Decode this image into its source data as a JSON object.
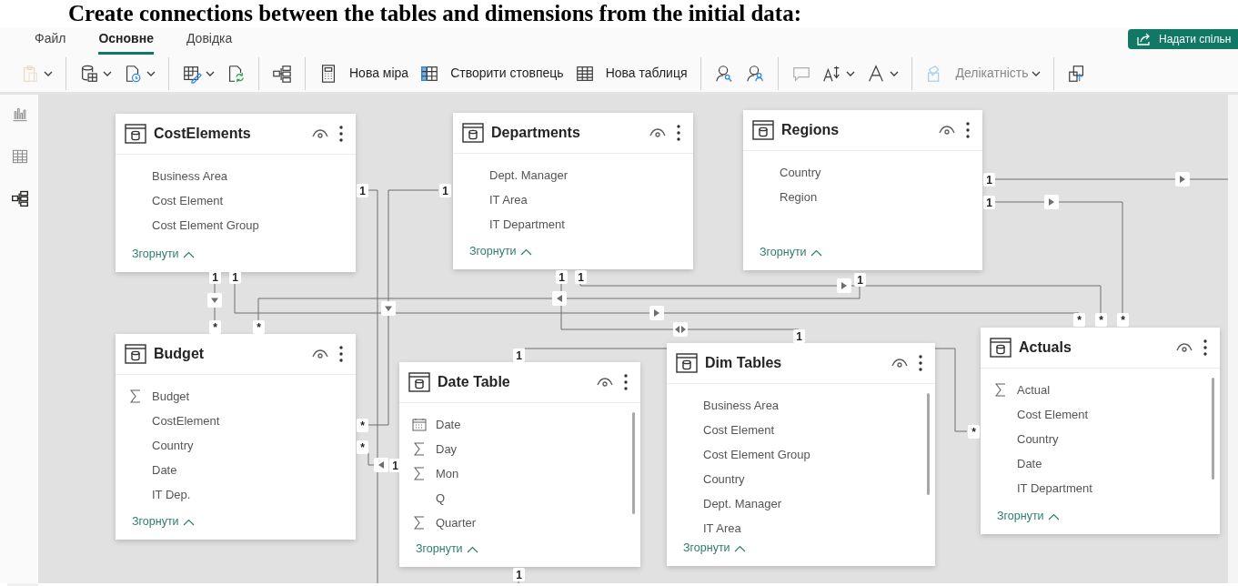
{
  "document_heading": "Create connections between the tables and dimensions from the initial data:",
  "menu": [
    {
      "label": "Файл",
      "selected": false
    },
    {
      "label": "Основне",
      "selected": true
    },
    {
      "label": "Довідка",
      "selected": false
    }
  ],
  "share_button": {
    "label": "Надати спільн"
  },
  "toolbar": [
    {
      "kind": "button",
      "dropdown": true,
      "disabled": true
    },
    {
      "kind": "separator"
    },
    {
      "kind": "button",
      "dropdown": true,
      "disabled": false
    },
    {
      "kind": "button",
      "dropdown": true,
      "disabled": false
    },
    {
      "kind": "separator"
    },
    {
      "kind": "button",
      "dropdown": true,
      "disabled": false
    },
    {
      "kind": "button",
      "dropdown": false,
      "disabled": false
    },
    {
      "kind": "separator"
    },
    {
      "kind": "button",
      "dropdown": false,
      "disabled": false
    },
    {
      "kind": "separator"
    },
    {
      "kind": "button",
      "label": "Нова міра",
      "dropdown": false,
      "disabled": false
    },
    {
      "kind": "button",
      "label": "Створити стовпець",
      "dropdown": false,
      "disabled": false
    },
    {
      "kind": "button",
      "label": "Нова таблиця",
      "dropdown": false,
      "disabled": false
    },
    {
      "kind": "separator"
    },
    {
      "kind": "button",
      "dropdown": false,
      "disabled": false
    },
    {
      "kind": "button",
      "dropdown": false,
      "disabled": false
    },
    {
      "kind": "separator"
    },
    {
      "kind": "button",
      "dropdown": false,
      "disabled": true
    },
    {
      "kind": "button",
      "dropdown": true,
      "disabled": false
    },
    {
      "kind": "button",
      "dropdown": true,
      "disabled": false
    },
    {
      "kind": "separator"
    },
    {
      "kind": "button",
      "label": "Делікатність",
      "dropdown": true,
      "disabled": true
    },
    {
      "kind": "separator"
    },
    {
      "kind": "button",
      "dropdown": false,
      "disabled": false
    }
  ],
  "rail": [
    {
      "selected": false
    },
    {
      "selected": false
    },
    {
      "selected": true
    }
  ],
  "tables": [
    {
      "name": "CostElements",
      "collapse_label": "Згорнути",
      "scrollable": false,
      "fields": [
        {
          "name": "Business Area",
          "kind": "column"
        },
        {
          "name": "Cost Element",
          "kind": "column"
        },
        {
          "name": "Cost Element Group",
          "kind": "column"
        }
      ]
    },
    {
      "name": "Departments",
      "collapse_label": "Згорнути",
      "scrollable": false,
      "fields": [
        {
          "name": "Dept. Manager",
          "kind": "column"
        },
        {
          "name": "IT Area",
          "kind": "column"
        },
        {
          "name": "IT Department",
          "kind": "column"
        }
      ]
    },
    {
      "name": "Regions",
      "collapse_label": "Згорнути",
      "scrollable": false,
      "fields": [
        {
          "name": "Country",
          "kind": "column"
        },
        {
          "name": "Region",
          "kind": "column"
        }
      ]
    },
    {
      "name": "Budget",
      "collapse_label": "Згорнути",
      "scrollable": false,
      "fields": [
        {
          "name": "Budget",
          "kind": "measure"
        },
        {
          "name": "CostElement",
          "kind": "column"
        },
        {
          "name": "Country",
          "kind": "column"
        },
        {
          "name": "Date",
          "kind": "column"
        },
        {
          "name": "IT Dep.",
          "kind": "column"
        }
      ]
    },
    {
      "name": "Date Table",
      "collapse_label": "Згорнути",
      "scrollable": true,
      "fields": [
        {
          "name": "Date",
          "kind": "date"
        },
        {
          "name": "Day",
          "kind": "measure"
        },
        {
          "name": "Mon",
          "kind": "measure"
        },
        {
          "name": "Q",
          "kind": "column"
        },
        {
          "name": "Quarter",
          "kind": "measure"
        }
      ]
    },
    {
      "name": "Dim Tables",
      "collapse_label": "Згорнути",
      "scrollable": true,
      "fields": [
        {
          "name": "Business Area",
          "kind": "column"
        },
        {
          "name": "Cost Element",
          "kind": "column"
        },
        {
          "name": "Cost Element Group",
          "kind": "column"
        },
        {
          "name": "Country",
          "kind": "column"
        },
        {
          "name": "Dept. Manager",
          "kind": "column"
        },
        {
          "name": "IT Area",
          "kind": "column"
        }
      ]
    },
    {
      "name": "Actuals",
      "collapse_label": "Згорнути",
      "scrollable": true,
      "fields": [
        {
          "name": "Actual",
          "kind": "measure"
        },
        {
          "name": "Cost Element",
          "kind": "column"
        },
        {
          "name": "Country",
          "kind": "column"
        },
        {
          "name": "Date",
          "kind": "column"
        },
        {
          "name": "IT Department",
          "kind": "column"
        }
      ]
    }
  ],
  "relationships": [
    {
      "from": "1",
      "to": "*",
      "bidirectional": false
    },
    {
      "from": "1",
      "to": "*",
      "bidirectional": false
    },
    {
      "from": "1",
      "to": "1",
      "bidirectional": true
    },
    {
      "from": "1",
      "to": "*",
      "bidirectional": false
    },
    {
      "from": "1",
      "to": "*",
      "bidirectional": false
    },
    {
      "from": "1",
      "bidirectional": false
    },
    {
      "from": "1",
      "to": "*",
      "bidirectional": false
    },
    {
      "from": "1"
    },
    {
      "from": "1",
      "to": "*",
      "bidirectional": false
    },
    {
      "from": "1",
      "to": "*",
      "bidirectional": false
    },
    {
      "from": "1",
      "to": "*"
    },
    {
      "from": "1"
    }
  ]
}
